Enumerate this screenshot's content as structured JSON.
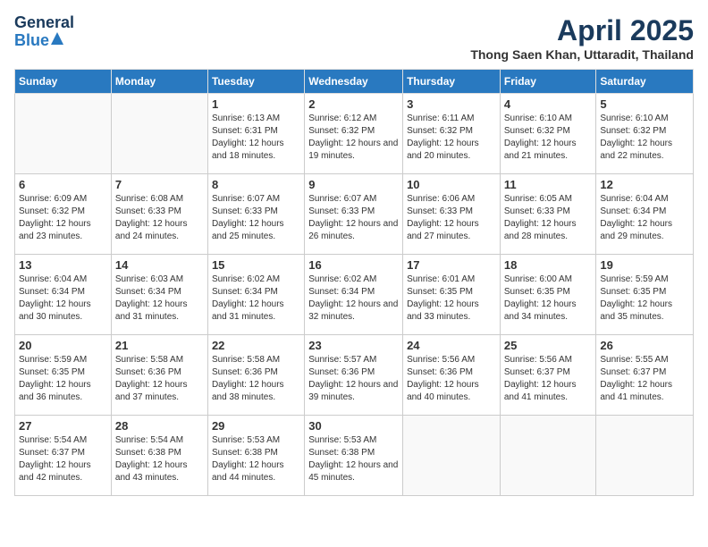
{
  "header": {
    "logo_general": "General",
    "logo_blue": "Blue",
    "title": "April 2025",
    "location": "Thong Saen Khan, Uttaradit, Thailand"
  },
  "days_of_week": [
    "Sunday",
    "Monday",
    "Tuesday",
    "Wednesday",
    "Thursday",
    "Friday",
    "Saturday"
  ],
  "weeks": [
    [
      {
        "day": "",
        "info": ""
      },
      {
        "day": "",
        "info": ""
      },
      {
        "day": "1",
        "info": "Sunrise: 6:13 AM\nSunset: 6:31 PM\nDaylight: 12 hours and 18 minutes."
      },
      {
        "day": "2",
        "info": "Sunrise: 6:12 AM\nSunset: 6:32 PM\nDaylight: 12 hours and 19 minutes."
      },
      {
        "day": "3",
        "info": "Sunrise: 6:11 AM\nSunset: 6:32 PM\nDaylight: 12 hours and 20 minutes."
      },
      {
        "day": "4",
        "info": "Sunrise: 6:10 AM\nSunset: 6:32 PM\nDaylight: 12 hours and 21 minutes."
      },
      {
        "day": "5",
        "info": "Sunrise: 6:10 AM\nSunset: 6:32 PM\nDaylight: 12 hours and 22 minutes."
      }
    ],
    [
      {
        "day": "6",
        "info": "Sunrise: 6:09 AM\nSunset: 6:32 PM\nDaylight: 12 hours and 23 minutes."
      },
      {
        "day": "7",
        "info": "Sunrise: 6:08 AM\nSunset: 6:33 PM\nDaylight: 12 hours and 24 minutes."
      },
      {
        "day": "8",
        "info": "Sunrise: 6:07 AM\nSunset: 6:33 PM\nDaylight: 12 hours and 25 minutes."
      },
      {
        "day": "9",
        "info": "Sunrise: 6:07 AM\nSunset: 6:33 PM\nDaylight: 12 hours and 26 minutes."
      },
      {
        "day": "10",
        "info": "Sunrise: 6:06 AM\nSunset: 6:33 PM\nDaylight: 12 hours and 27 minutes."
      },
      {
        "day": "11",
        "info": "Sunrise: 6:05 AM\nSunset: 6:33 PM\nDaylight: 12 hours and 28 minutes."
      },
      {
        "day": "12",
        "info": "Sunrise: 6:04 AM\nSunset: 6:34 PM\nDaylight: 12 hours and 29 minutes."
      }
    ],
    [
      {
        "day": "13",
        "info": "Sunrise: 6:04 AM\nSunset: 6:34 PM\nDaylight: 12 hours and 30 minutes."
      },
      {
        "day": "14",
        "info": "Sunrise: 6:03 AM\nSunset: 6:34 PM\nDaylight: 12 hours and 31 minutes."
      },
      {
        "day": "15",
        "info": "Sunrise: 6:02 AM\nSunset: 6:34 PM\nDaylight: 12 hours and 31 minutes."
      },
      {
        "day": "16",
        "info": "Sunrise: 6:02 AM\nSunset: 6:34 PM\nDaylight: 12 hours and 32 minutes."
      },
      {
        "day": "17",
        "info": "Sunrise: 6:01 AM\nSunset: 6:35 PM\nDaylight: 12 hours and 33 minutes."
      },
      {
        "day": "18",
        "info": "Sunrise: 6:00 AM\nSunset: 6:35 PM\nDaylight: 12 hours and 34 minutes."
      },
      {
        "day": "19",
        "info": "Sunrise: 5:59 AM\nSunset: 6:35 PM\nDaylight: 12 hours and 35 minutes."
      }
    ],
    [
      {
        "day": "20",
        "info": "Sunrise: 5:59 AM\nSunset: 6:35 PM\nDaylight: 12 hours and 36 minutes."
      },
      {
        "day": "21",
        "info": "Sunrise: 5:58 AM\nSunset: 6:36 PM\nDaylight: 12 hours and 37 minutes."
      },
      {
        "day": "22",
        "info": "Sunrise: 5:58 AM\nSunset: 6:36 PM\nDaylight: 12 hours and 38 minutes."
      },
      {
        "day": "23",
        "info": "Sunrise: 5:57 AM\nSunset: 6:36 PM\nDaylight: 12 hours and 39 minutes."
      },
      {
        "day": "24",
        "info": "Sunrise: 5:56 AM\nSunset: 6:36 PM\nDaylight: 12 hours and 40 minutes."
      },
      {
        "day": "25",
        "info": "Sunrise: 5:56 AM\nSunset: 6:37 PM\nDaylight: 12 hours and 41 minutes."
      },
      {
        "day": "26",
        "info": "Sunrise: 5:55 AM\nSunset: 6:37 PM\nDaylight: 12 hours and 41 minutes."
      }
    ],
    [
      {
        "day": "27",
        "info": "Sunrise: 5:54 AM\nSunset: 6:37 PM\nDaylight: 12 hours and 42 minutes."
      },
      {
        "day": "28",
        "info": "Sunrise: 5:54 AM\nSunset: 6:38 PM\nDaylight: 12 hours and 43 minutes."
      },
      {
        "day": "29",
        "info": "Sunrise: 5:53 AM\nSunset: 6:38 PM\nDaylight: 12 hours and 44 minutes."
      },
      {
        "day": "30",
        "info": "Sunrise: 5:53 AM\nSunset: 6:38 PM\nDaylight: 12 hours and 45 minutes."
      },
      {
        "day": "",
        "info": ""
      },
      {
        "day": "",
        "info": ""
      },
      {
        "day": "",
        "info": ""
      }
    ]
  ]
}
